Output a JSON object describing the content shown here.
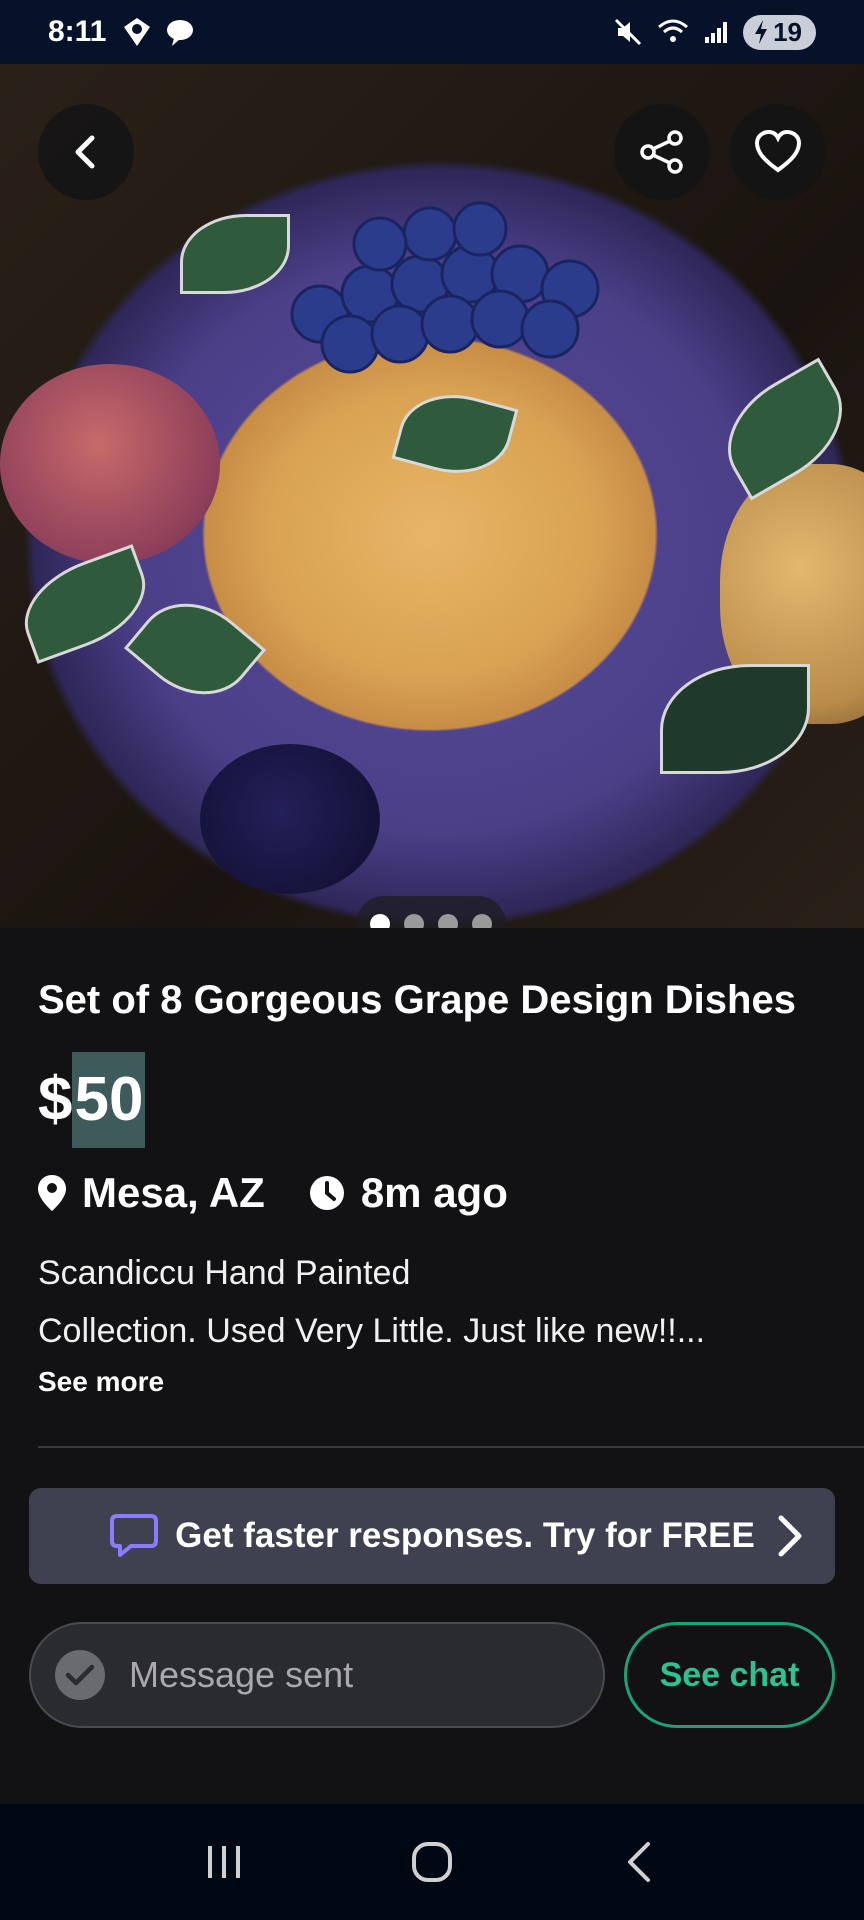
{
  "status_bar": {
    "time": "8:11",
    "battery": "19"
  },
  "hero": {
    "image_description_icon": "photo",
    "dots": [
      true,
      false,
      false,
      false
    ]
  },
  "listing": {
    "title": "Set of 8 Gorgeous Grape Design Dishes",
    "price_symbol": "$",
    "price_amount": "50",
    "location": "Mesa, AZ",
    "posted": "8m ago",
    "description_line1": "Scandiccu Hand Painted",
    "description_line2": "Collection. Used Very Little. Just like new!!...",
    "see_more": "See more"
  },
  "promo": {
    "text": "Get faster responses. Try for FREE"
  },
  "message": {
    "status": "Message sent",
    "see_chat": "See chat"
  },
  "colors": {
    "accent_green": "#2fc094",
    "promo_bubble": "#8a7cff",
    "background": "#121214"
  }
}
